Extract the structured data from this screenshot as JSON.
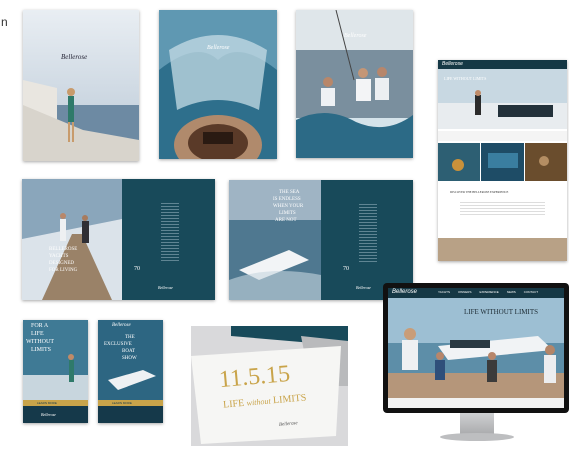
{
  "page": {
    "edge_text": "n"
  },
  "cover_yacht": {
    "logo": "Bellerose"
  },
  "cover_wake": {
    "logo": "Bellerose"
  },
  "cover_crew": {
    "logo": "Bellerose"
  },
  "web_page": {
    "logo": "Bellerose",
    "headline": "LIFE WITHOUT LIMITS",
    "section_title": "DISCOVER THE BELLEROSE EXPERIENCE"
  },
  "spread_one": {
    "headline_lines": [
      "BELLEROSE",
      "YACHTS",
      "DESIGNED",
      "FOR LIVING"
    ],
    "model": "70",
    "logo": "Bellerose"
  },
  "spread_two": {
    "headline_lines": [
      "THE SEA",
      "IS ENDLESS",
      "WHEN YOUR",
      "LIMITS",
      "ARE NOT"
    ],
    "model": "70",
    "logo": "Bellerose"
  },
  "banner_one": {
    "lines": [
      "FOR A",
      "LIFE",
      "WITHOUT",
      "LIMITS"
    ],
    "cta": "LEARN MORE",
    "logo": "Bellerose"
  },
  "banner_two": {
    "lines": [
      "THE",
      "EXCLUSIVE",
      "BOAT",
      "SHOW"
    ],
    "cta": "LEARN MORE",
    "logo": "Bellerose"
  },
  "invitation": {
    "date": "11.5.15",
    "tag_prefix": "LIFE",
    "tag_mid": "without",
    "tag_suffix": "LIMITS",
    "logo": "Bellerose"
  },
  "monitor": {
    "logo": "Bellerose",
    "headline": "LIFE WITHOUT LIMITS",
    "nav": [
      "YACHTS",
      "OWNERS",
      "EXPERIENCE",
      "NEWS",
      "CONTACT"
    ]
  },
  "colors": {
    "navy": "#184a5a",
    "sea": "#2f6f8c",
    "gold": "#c9a44a",
    "sand": "#c9b49a"
  }
}
